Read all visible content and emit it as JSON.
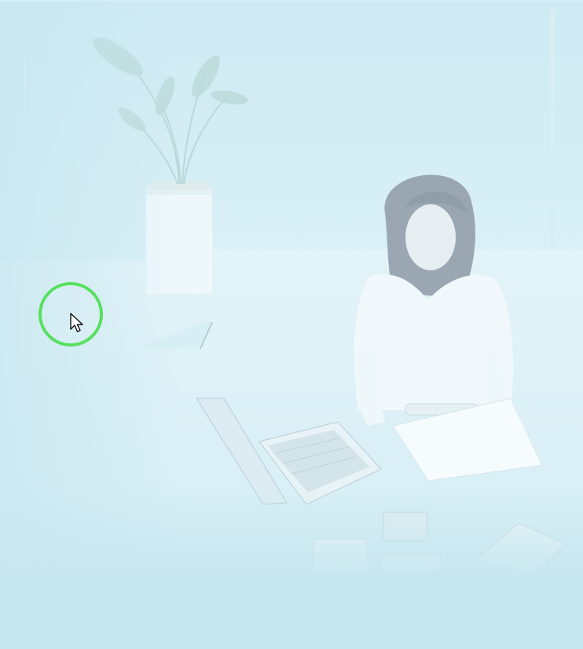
{
  "page": {
    "background_color": "#c6e6ef"
  },
  "hero_image": {
    "icon": "office-worker-photo",
    "tint_color": "#cbe9f2"
  },
  "cursor": {
    "icon": "mouse-pointer-icon",
    "highlight_color": "#57e05f"
  }
}
